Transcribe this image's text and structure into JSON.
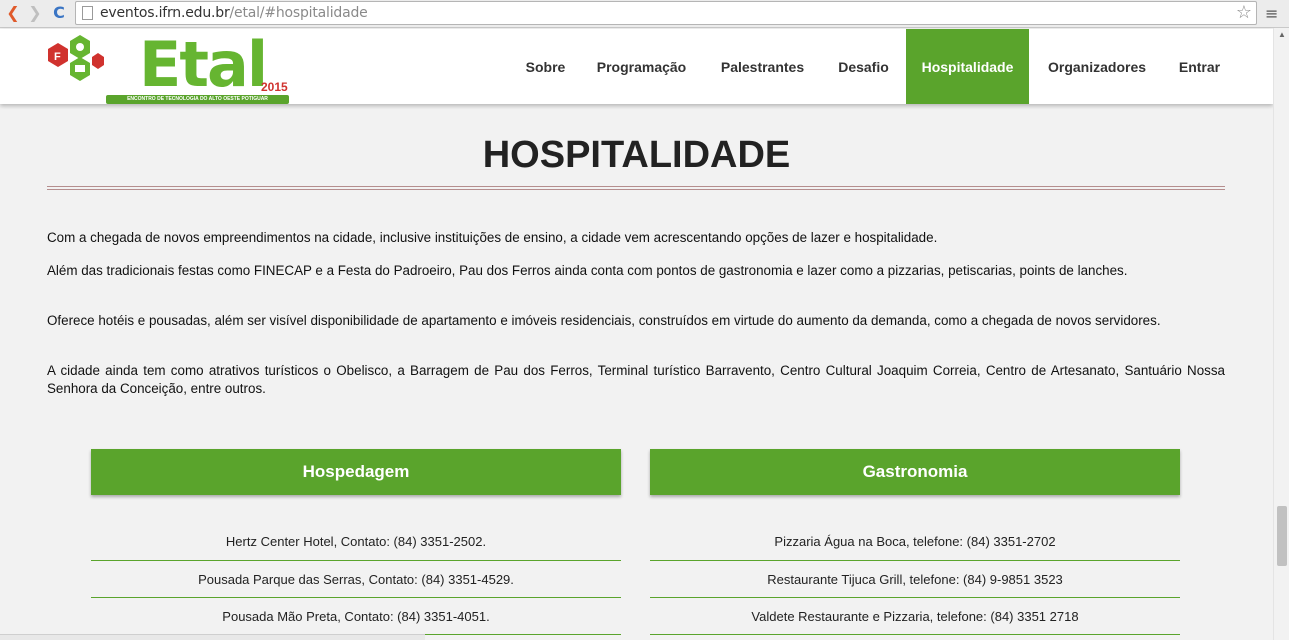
{
  "browser": {
    "url_host": "eventos.ifrn.edu.br",
    "url_path": "/etal/#hospitalidade"
  },
  "logo": {
    "word": "Etal",
    "year": "2015",
    "tagline": "ENCONTRO DE TECNOLOGIA DO ALTO OESTE POTIGUAR"
  },
  "nav": {
    "items": [
      {
        "label": "Sobre"
      },
      {
        "label": "Programação"
      },
      {
        "label": "Palestrantes"
      },
      {
        "label": "Desafio"
      },
      {
        "label": "Hospitalidade",
        "active": true
      },
      {
        "label": "Organizadores"
      },
      {
        "label": "Entrar"
      }
    ]
  },
  "page": {
    "title": "HOSPITALIDADE",
    "paragraphs": [
      "Com a chegada de novos empreendimentos na cidade, inclusive instituições de ensino, a cidade vem acrescentando opções de lazer e hospitalidade.",
      "Além das tradicionais festas como FINECAP e a Festa do Padroeiro, Pau dos Ferros ainda conta com pontos de gastronomia e lazer como a pizzarias, petiscarias, points de lanches.",
      "Oferece hotéis e pousadas, além ser visível disponibilidade de apartamento e imóveis residenciais, construídos em virtude do aumento da demanda, como a chegada de novos servidores.",
      "A cidade ainda tem como atrativos turísticos o Obelisco, a Barragem de Pau dos Ferros, Terminal turístico Barravento, Centro Cultural Joaquim Correia, Centro de Artesanato, Santuário Nossa Senhora da Conceição, entre outros."
    ]
  },
  "hospedagem": {
    "heading": "Hospedagem",
    "items": [
      "Hertz Center Hotel, Contato: (84) 3351-2502.",
      "Pousada Parque das Serras, Contato: (84) 3351-4529.",
      "Pousada Mão Preta, Contato: (84) 3351-4051."
    ]
  },
  "gastronomia": {
    "heading": "Gastronomia",
    "items": [
      "Pizzaria Água na Boca, telefone: (84) 3351-2702",
      "Restaurante Tijuca Grill, telefone: (84) 9-9851 3523",
      "Valdete Restaurante e Pizzaria, telefone: (84) 3351 2718"
    ]
  },
  "colors": {
    "accent_green": "#5aa42c",
    "logo_red": "#d0322e"
  }
}
